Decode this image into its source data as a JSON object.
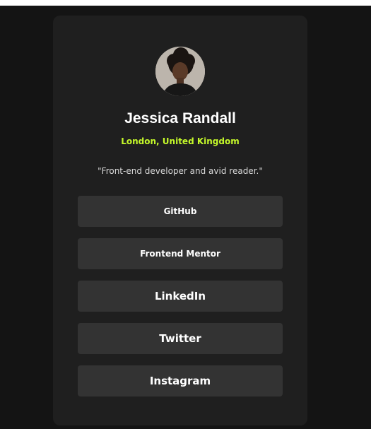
{
  "profile": {
    "name": "Jessica Randall",
    "location": "London, United Kingdom",
    "bio": "\"Front-end developer and avid reader.\""
  },
  "links": [
    {
      "label": "GitHub"
    },
    {
      "label": "Frontend Mentor"
    },
    {
      "label": "LinkedIn"
    },
    {
      "label": "Twitter"
    },
    {
      "label": "Instagram"
    }
  ],
  "colors": {
    "background": "#141414",
    "card": "#1f1f1f",
    "button": "#333333",
    "accent": "#c4f82a",
    "text": "#ffffff"
  }
}
